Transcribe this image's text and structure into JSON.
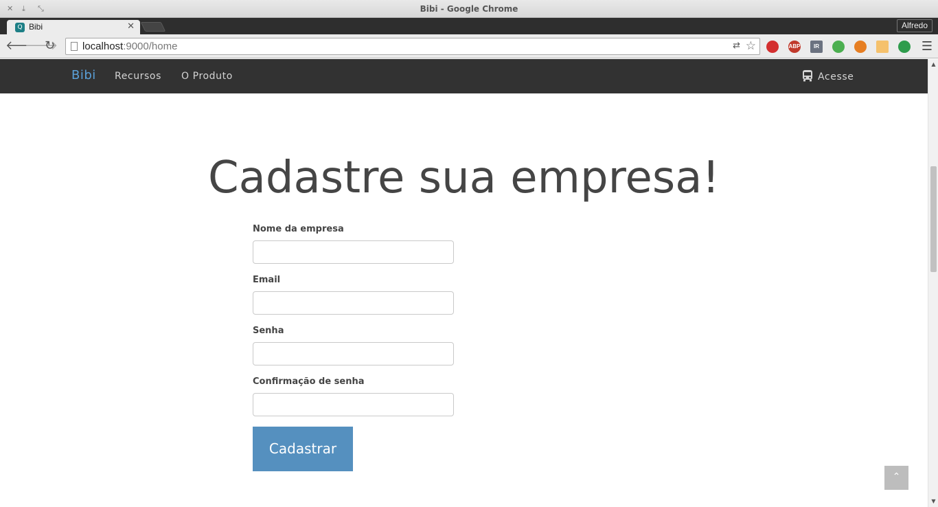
{
  "window": {
    "title": "Bibi - Google Chrome"
  },
  "tabs": [
    {
      "title": "Bibi"
    }
  ],
  "profile": {
    "name": "Alfredo"
  },
  "address_bar": {
    "host": "localhost",
    "rest": ":9000/home"
  },
  "extensions": [
    {
      "name": "extension-red-icon",
      "label": "",
      "color": "#d32f2f"
    },
    {
      "name": "adblock-icon",
      "label": "ABP",
      "color": "#c0392b"
    },
    {
      "name": "readability-icon",
      "label": "IR",
      "color": "#6b7280"
    },
    {
      "name": "evernote-icon",
      "label": "",
      "color": "#4caf50"
    },
    {
      "name": "chrome-ext-icon",
      "label": "",
      "color": "#e67e22"
    },
    {
      "name": "shop-icon",
      "label": "",
      "color": "#f5c16c"
    },
    {
      "name": "pushbullet-icon",
      "label": "",
      "color": "#2e9c4c"
    }
  ],
  "site_nav": {
    "brand": "Bibi",
    "links": [
      "Recursos",
      "O Produto"
    ],
    "login": "Acesse"
  },
  "page": {
    "heading": "Cadastre sua empresa!",
    "fields": [
      {
        "label": "Nome da empresa",
        "value": ""
      },
      {
        "label": "Email",
        "value": ""
      },
      {
        "label": "Senha",
        "value": ""
      },
      {
        "label": "Confirmação de senha",
        "value": ""
      }
    ],
    "submit": "Cadastrar"
  },
  "colors": {
    "brand": "#5aa0d8",
    "button": "#5590bf",
    "navbar": "#323232"
  }
}
